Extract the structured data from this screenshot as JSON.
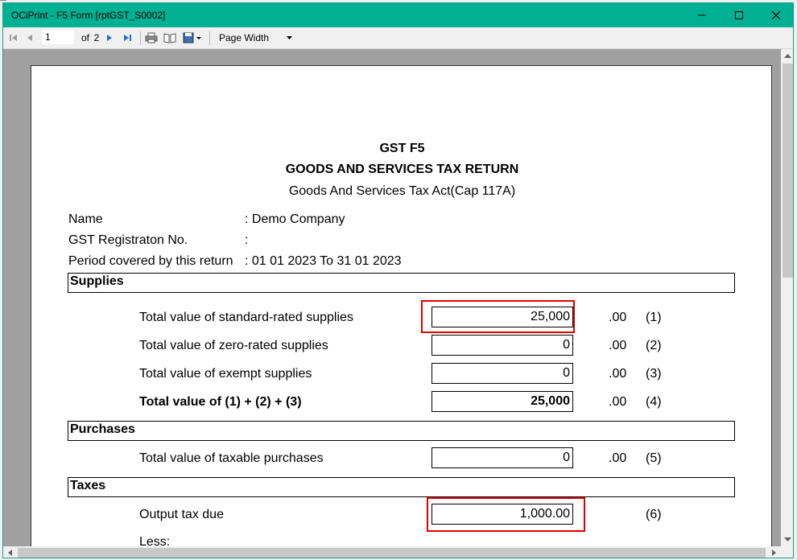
{
  "window": {
    "title": "OCiPrint - F5 Form [rptGST_S0002]"
  },
  "toolbar": {
    "page_number": "1",
    "of_label": "of",
    "page_total": "2",
    "zoom_label": "Page Width"
  },
  "report": {
    "heading1": "GST F5",
    "heading2": "GOODS AND SERVICES TAX RETURN",
    "heading3": "Goods And Services Tax Act(Cap 117A)",
    "fields": [
      {
        "label": "Name",
        "value": ": Demo Company"
      },
      {
        "label": "GST Registraton No.",
        "value": ":"
      },
      {
        "label": "Period covered by this return",
        "value": ": 01 01 2023 To 31 01 2023"
      }
    ],
    "sections": {
      "supplies": "Supplies",
      "purchases": "Purchases",
      "taxes": "Taxes"
    },
    "rows": [
      {
        "label": "Total value of standard-rated supplies",
        "value": "25,000",
        "cents": ".00",
        "ref": "(1)"
      },
      {
        "label": "Total value of zero-rated supplies",
        "value": "0",
        "cents": ".00",
        "ref": "(2)"
      },
      {
        "label": "Total value of exempt supplies",
        "value": "0",
        "cents": ".00",
        "ref": "(3)"
      },
      {
        "label": "Total value of (1) + (2) + (3)",
        "value": "25,000",
        "cents": ".00",
        "ref": "(4)"
      },
      {
        "label": "Total value of taxable purchases",
        "value": "0",
        "cents": ".00",
        "ref": "(5)"
      },
      {
        "label": "Output tax due",
        "value": "1,000.00",
        "ref": "(6)"
      },
      {
        "label": "Less:"
      }
    ]
  },
  "colors": {
    "titlebar": "#00b092",
    "highlight": "#e00000",
    "viewport": "#a0a0a0"
  }
}
